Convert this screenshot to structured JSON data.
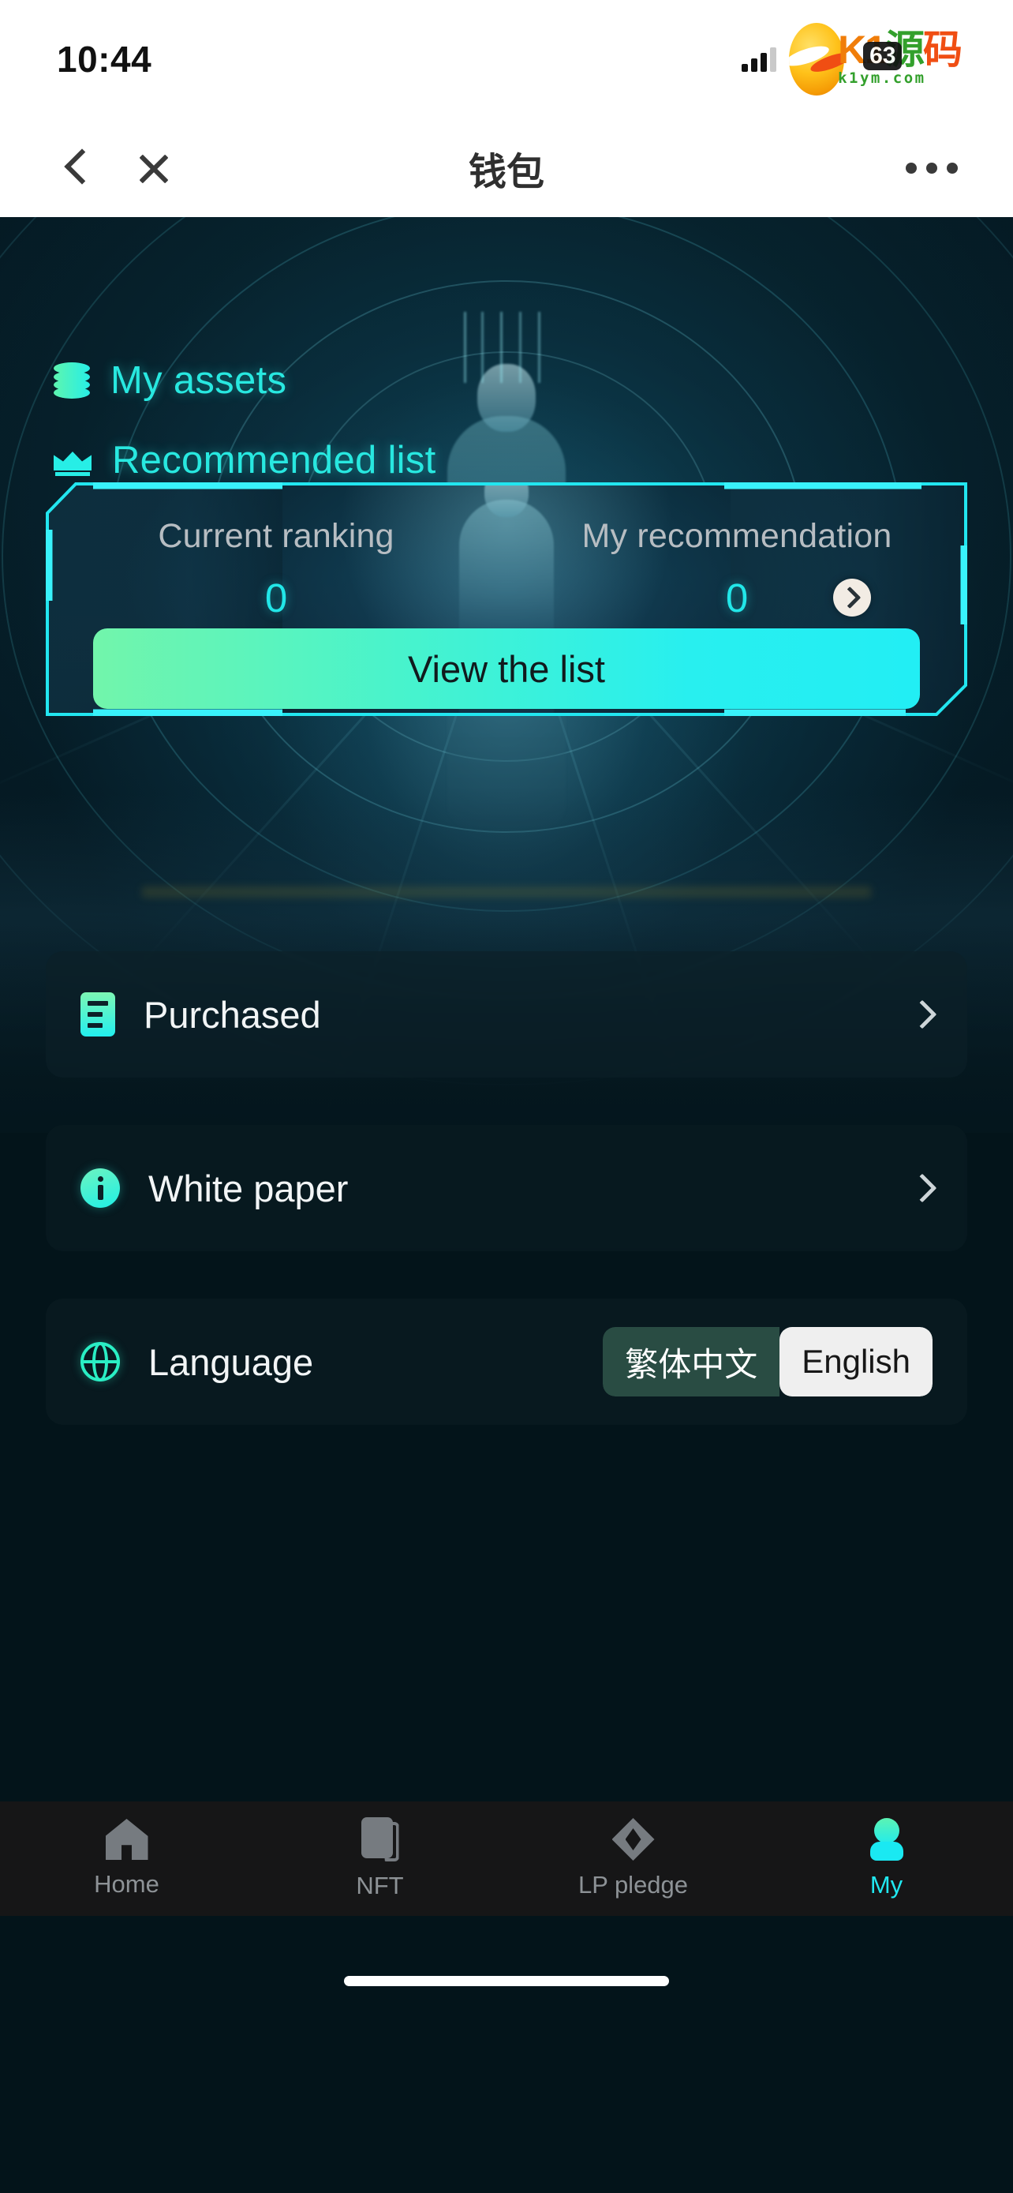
{
  "status_bar": {
    "time": "10:44",
    "signal_icon": "signal-bars-icon",
    "battery_level": "63",
    "watermark": {
      "logo_icon": "egg-logo-icon",
      "line1_k": "K1",
      "line1_y": "源",
      "line1_m": "码",
      "line2": "k1ym.com"
    }
  },
  "nav_bar": {
    "back_icon": "chevron-left-icon",
    "close_icon": "close-icon",
    "title": "钱包",
    "more_icon": "more-horizontal-icon"
  },
  "sections": {
    "my_assets": {
      "icon": "coins-stack-icon",
      "label": "My assets"
    },
    "recommended_list": {
      "icon": "crown-icon",
      "label": "Recommended list"
    }
  },
  "rank_card": {
    "stats": [
      {
        "label": "Current ranking",
        "value": "0"
      },
      {
        "label": "My recommendation",
        "value": "0"
      }
    ],
    "go_icon": "chevron-right-circle-icon",
    "view_button": "View the list",
    "border_color": "#22e6f0",
    "button_gradient_from": "#72f5ab",
    "button_gradient_to": "#22eef4"
  },
  "menu_rows": [
    {
      "icon": "document-list-icon",
      "label": "Purchased",
      "chevron": "chevron-right-icon"
    },
    {
      "icon": "info-circle-icon",
      "label": "White paper",
      "chevron": "chevron-right-icon"
    }
  ],
  "language_row": {
    "icon": "globe-icon",
    "label": "Language",
    "options": [
      {
        "label": "繁体中文",
        "selected": false
      },
      {
        "label": "English",
        "selected": true
      }
    ]
  },
  "tab_bar": {
    "items": [
      {
        "icon": "home-icon",
        "label": "Home",
        "active": false
      },
      {
        "icon": "nft-card-icon",
        "label": "NFT",
        "active": false
      },
      {
        "icon": "diamond-icon",
        "label": "LP pledge",
        "active": false
      },
      {
        "icon": "person-icon",
        "label": "My",
        "active": true
      }
    ],
    "active_color": "#21e8f0",
    "inactive_color": "#8d9296"
  }
}
